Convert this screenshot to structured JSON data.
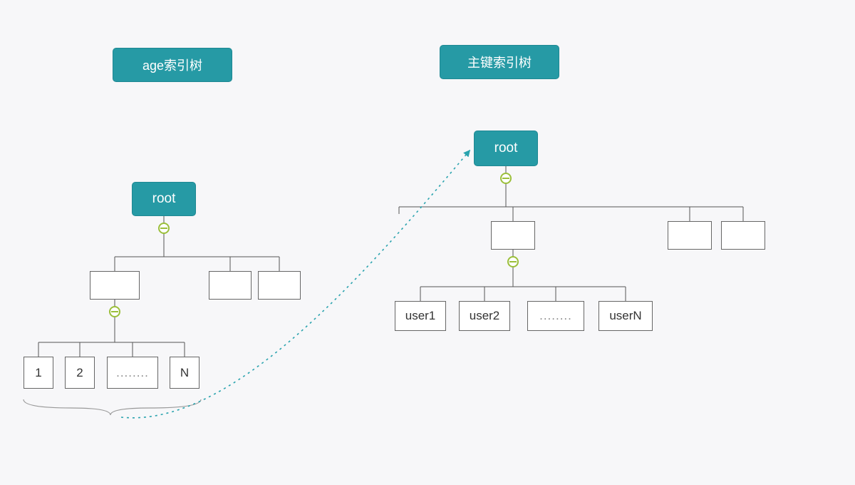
{
  "left_tree": {
    "title": "age索引树",
    "root": "root",
    "leaves": [
      "1",
      "2",
      "........",
      "N"
    ]
  },
  "right_tree": {
    "title": "主键索引树",
    "root": "root",
    "leaves": [
      "user1",
      "user2",
      "........",
      "userN"
    ]
  },
  "colors": {
    "teal": "#269aa5",
    "line": "#555",
    "arrow": "#2aa3ae"
  }
}
